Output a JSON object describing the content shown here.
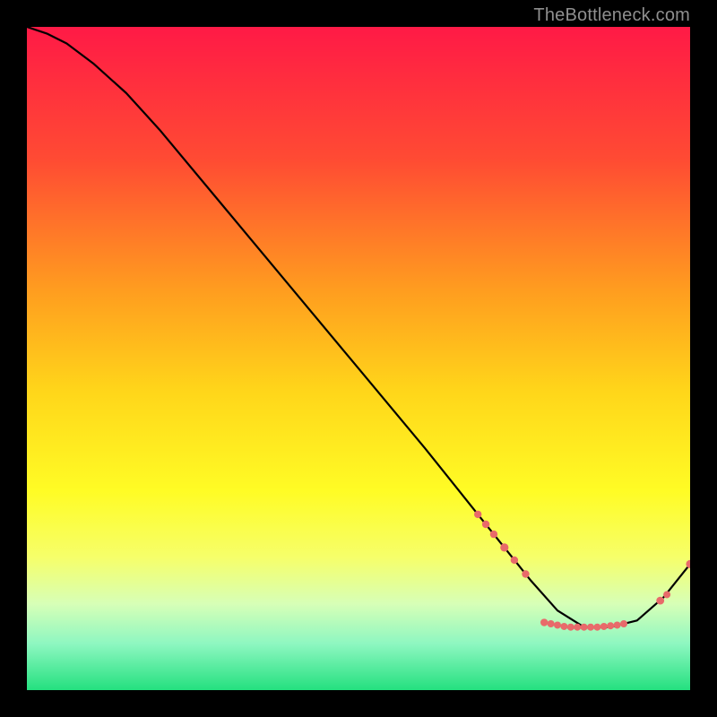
{
  "watermark": "TheBottleneck.com",
  "chart_data": {
    "type": "line",
    "title": "",
    "xlabel": "",
    "ylabel": "",
    "xlim": [
      0,
      100
    ],
    "ylim": [
      0,
      100
    ],
    "gradient_stops": [
      {
        "offset": 0.0,
        "color": "#ff1a46"
      },
      {
        "offset": 0.2,
        "color": "#ff4b33"
      },
      {
        "offset": 0.4,
        "color": "#ff9e1f"
      },
      {
        "offset": 0.55,
        "color": "#ffd61a"
      },
      {
        "offset": 0.7,
        "color": "#fffc25"
      },
      {
        "offset": 0.8,
        "color": "#f6ff6a"
      },
      {
        "offset": 0.87,
        "color": "#d7ffb7"
      },
      {
        "offset": 0.93,
        "color": "#8ef7c1"
      },
      {
        "offset": 1.0,
        "color": "#24e07f"
      }
    ],
    "series": [
      {
        "name": "bottleneck-curve",
        "color": "#000000",
        "x": [
          0,
          3,
          6,
          10,
          15,
          20,
          30,
          40,
          50,
          60,
          68,
          72,
          76,
          80,
          84,
          88,
          92,
          96,
          100
        ],
        "y": [
          100,
          99,
          97.5,
          94.5,
          90,
          84.5,
          72.5,
          60.5,
          48.5,
          36.5,
          26.5,
          21.5,
          16.5,
          12,
          9.5,
          9.5,
          10.5,
          14,
          19
        ]
      }
    ],
    "markers": {
      "name": "highlight-dots",
      "color": "#e86a6a",
      "radius_default": 4.2,
      "points": [
        {
          "x": 68.0,
          "y": 26.5,
          "r": 4.2
        },
        {
          "x": 69.2,
          "y": 25.0,
          "r": 4.2
        },
        {
          "x": 70.4,
          "y": 23.5,
          "r": 4.2
        },
        {
          "x": 72.0,
          "y": 21.5,
          "r": 4.6
        },
        {
          "x": 73.5,
          "y": 19.6,
          "r": 4.2
        },
        {
          "x": 75.2,
          "y": 17.5,
          "r": 4.2
        },
        {
          "x": 78.0,
          "y": 10.2,
          "r": 4.2
        },
        {
          "x": 79.0,
          "y": 10.0,
          "r": 4.0
        },
        {
          "x": 80.0,
          "y": 9.8,
          "r": 4.0
        },
        {
          "x": 81.0,
          "y": 9.6,
          "r": 4.0
        },
        {
          "x": 82.0,
          "y": 9.5,
          "r": 4.0
        },
        {
          "x": 83.0,
          "y": 9.5,
          "r": 4.0
        },
        {
          "x": 84.0,
          "y": 9.5,
          "r": 4.0
        },
        {
          "x": 85.0,
          "y": 9.5,
          "r": 4.0
        },
        {
          "x": 86.0,
          "y": 9.5,
          "r": 4.0
        },
        {
          "x": 87.0,
          "y": 9.6,
          "r": 4.0
        },
        {
          "x": 88.0,
          "y": 9.7,
          "r": 4.0
        },
        {
          "x": 89.0,
          "y": 9.8,
          "r": 4.0
        },
        {
          "x": 90.0,
          "y": 10.0,
          "r": 4.0
        },
        {
          "x": 95.5,
          "y": 13.5,
          "r": 4.4
        },
        {
          "x": 96.5,
          "y": 14.4,
          "r": 4.0
        },
        {
          "x": 100.0,
          "y": 19.0,
          "r": 4.6
        }
      ]
    }
  }
}
